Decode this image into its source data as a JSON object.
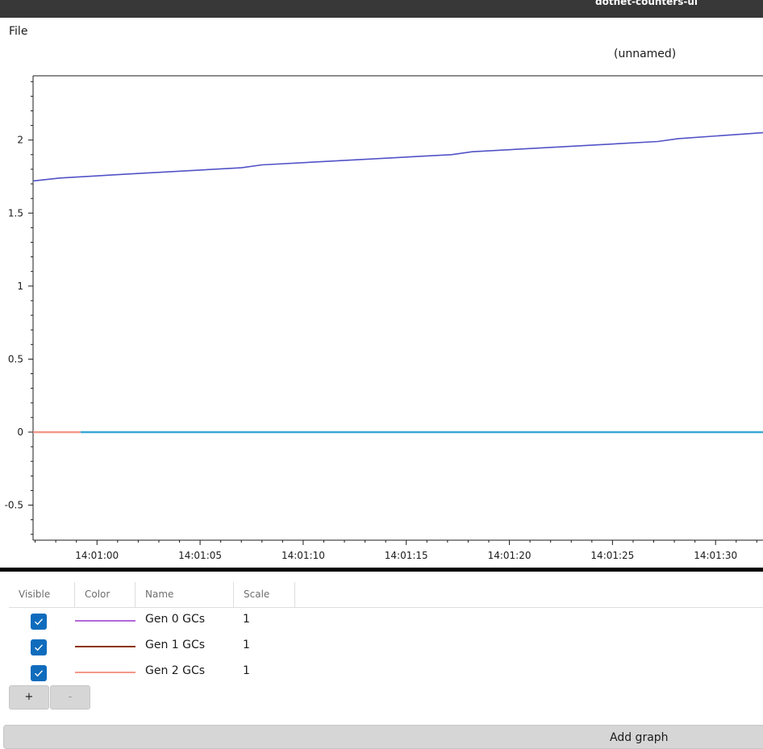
{
  "app": {
    "title": "dotnet-counters-ui"
  },
  "menu": {
    "file_label": "File"
  },
  "chart_data": {
    "type": "line",
    "title": "(unnamed)",
    "xlabel": "",
    "ylabel": "",
    "x_ticks": [
      "14:01:00",
      "14:01:05",
      "14:01:10",
      "14:01:15",
      "14:01:20",
      "14:01:25",
      "14:01:30"
    ],
    "xlim_seconds_from_14_01_00": [
      -3.1,
      32.3
    ],
    "y_ticks": [
      "-0.5",
      "0",
      "0.5",
      "1",
      "1.5",
      "2"
    ],
    "ylim": [
      -0.74,
      2.44
    ],
    "grid": false,
    "series": [
      {
        "color": "#5252c8",
        "points": [
          [
            -3.1,
            1.72
          ],
          [
            -1.8,
            1.74
          ],
          [
            1.8,
            1.77
          ],
          [
            7.0,
            1.81
          ],
          [
            8.0,
            1.83
          ],
          [
            17.2,
            1.9
          ],
          [
            18.2,
            1.92
          ],
          [
            27.2,
            1.99
          ],
          [
            28.2,
            2.01
          ],
          [
            32.3,
            2.05
          ]
        ]
      },
      {
        "color": "#3aa8d6",
        "points": [
          [
            -0.8,
            0
          ],
          [
            32.3,
            0
          ]
        ]
      },
      {
        "color": "#f3988a",
        "points": [
          [
            -3.1,
            0
          ],
          [
            -0.8,
            0
          ]
        ]
      }
    ]
  },
  "series_table": {
    "headers": {
      "visible": "Visible",
      "color": "Color",
      "name": "Name",
      "scale": "Scale"
    },
    "rows": [
      {
        "name": "Gen 0 GCs",
        "scale": "1",
        "color": "#b467d6",
        "visible": true
      },
      {
        "name": "Gen 1 GCs",
        "scale": "1",
        "color": "#8b3300",
        "visible": true
      },
      {
        "name": "Gen 2 GCs",
        "scale": "1",
        "color": "#f3988a",
        "visible": true
      }
    ]
  },
  "buttons": {
    "add_series": "+",
    "remove_series": "-",
    "add_graph": "Add graph"
  }
}
